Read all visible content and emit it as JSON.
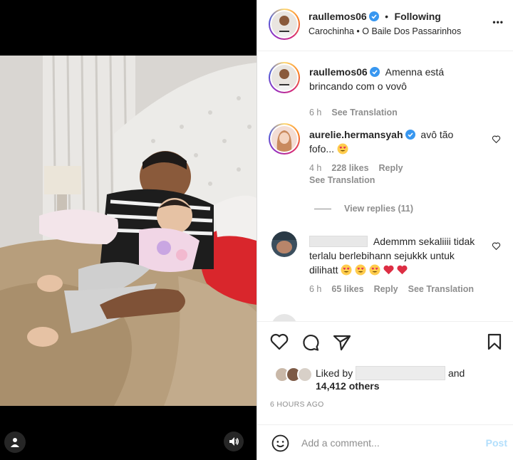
{
  "header": {
    "username": "raullemos06",
    "separator": "•",
    "follow_status": "Following",
    "audio": "Carochinha • O Baile Dos Passarinhos",
    "more_label": "•••"
  },
  "caption": {
    "username": "raullemos06",
    "text_line1": "Amenna está",
    "text_line2": "brincando com o vovô",
    "time": "6 h",
    "see_translation": "See Translation"
  },
  "comments": [
    {
      "username": "aurelie.hermansyah",
      "text_line1": "avô tão",
      "text_line2": "fofo...",
      "time": "4 h",
      "likes": "228 likes",
      "reply": "Reply",
      "see_translation": "See Translation",
      "view_replies": "View replies (11)"
    },
    {
      "text_line1": "Ademmm sekaliiii tidak",
      "text_line2": "terlalu berlebihann sejukkk untuk",
      "text_line3": "dilihatt",
      "time": "6 h",
      "likes": "65 likes",
      "reply": "Reply",
      "see_translation": "See Translation"
    }
  ],
  "likes": {
    "liked_by": "Liked by",
    "and": "and",
    "others": "14,412 others"
  },
  "timestamp": "6 HOURS AGO",
  "add_comment": {
    "placeholder": "Add a comment...",
    "post": "Post"
  },
  "colors": {
    "verified": "#3897f0",
    "heart_red": "#ed4956",
    "link_blue": "#b2dffc"
  }
}
